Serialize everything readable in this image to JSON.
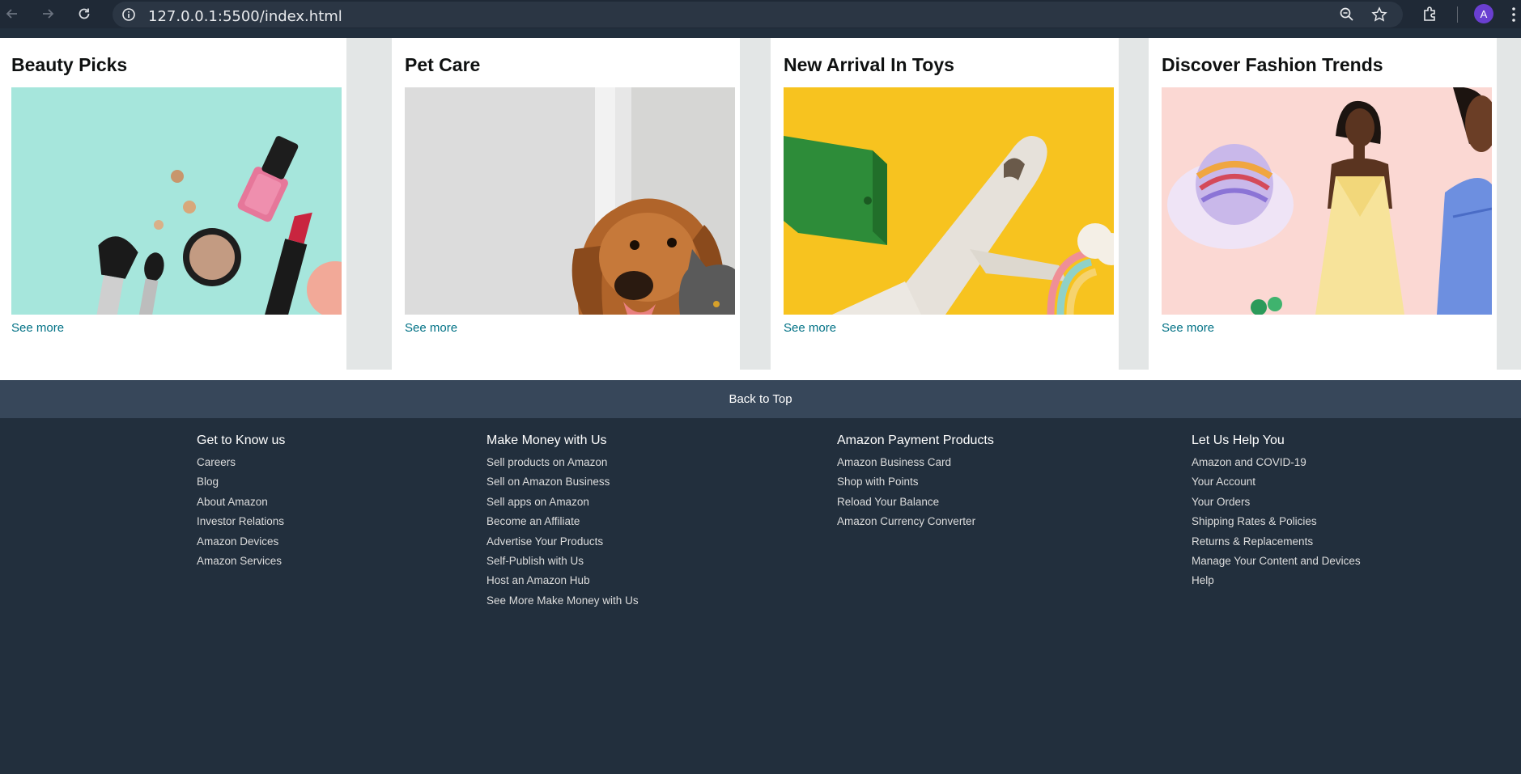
{
  "browser": {
    "url": "127.0.0.1:5500/index.html",
    "avatar_letter": "A",
    "icons": [
      "back-icon",
      "forward-icon",
      "reload-icon",
      "site-info-icon",
      "zoom-icon",
      "bookmark-star-icon",
      "extensions-icon",
      "menu-kebab-icon"
    ]
  },
  "cards": [
    {
      "title": "Beauty Picks",
      "link": "See more",
      "image": "beauty-products"
    },
    {
      "title": "Pet Care",
      "link": "See more",
      "image": "dog-and-cat"
    },
    {
      "title": "New Arrival In Toys",
      "link": "See more",
      "image": "toy-airplane"
    },
    {
      "title": "Discover Fashion Trends",
      "link": "See more",
      "image": "fashion-models"
    }
  ],
  "back_to_top": "Back to Top",
  "footer": {
    "columns": [
      {
        "heading": "Get to Know us",
        "links": [
          "Careers",
          "Blog",
          "About Amazon",
          "Investor Relations",
          "Amazon Devices",
          "Amazon Services"
        ]
      },
      {
        "heading": "Make Money with Us",
        "links": [
          "Sell products on Amazon",
          "Sell on Amazon Business",
          "Sell apps on Amazon",
          "Become an Affiliate",
          "Advertise Your Products",
          "Self-Publish with Us",
          "Host an Amazon Hub",
          "See More Make Money with Us"
        ]
      },
      {
        "heading": "Amazon Payment Products",
        "links": [
          "Amazon Business Card",
          "Shop with Points",
          "Reload Your Balance",
          "Amazon Currency Converter"
        ]
      },
      {
        "heading": "Let Us Help You",
        "links": [
          "Amazon and COVID-19",
          "Your Account",
          "Your Orders",
          "Shipping Rates & Policies",
          "Returns & Replacements",
          "Manage Your Content and Devices",
          "Help"
        ]
      }
    ]
  },
  "colors": {
    "link": "#007185",
    "footer_bg": "#222f3d",
    "back_to_top_bg": "#37475a"
  }
}
